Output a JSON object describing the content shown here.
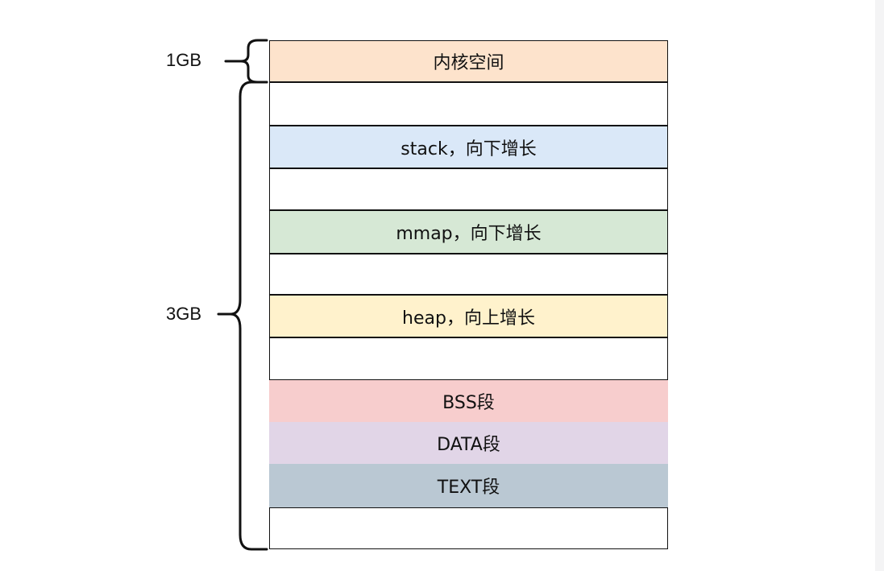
{
  "memory_layout": {
    "size_labels": {
      "kernel": "1GB",
      "user": "3GB"
    },
    "segments": [
      {
        "id": "kernel",
        "label": "内核空间",
        "color": "#fde3cc"
      },
      {
        "id": "gap1",
        "label": "",
        "color": "#ffffff"
      },
      {
        "id": "stack",
        "label": "stack，向下增长",
        "color": "#dae8f8"
      },
      {
        "id": "gap2",
        "label": "",
        "color": "#ffffff"
      },
      {
        "id": "mmap",
        "label": "mmap，向下增长",
        "color": "#d6e8d5"
      },
      {
        "id": "gap3",
        "label": "",
        "color": "#ffffff"
      },
      {
        "id": "heap",
        "label": "heap，向上增长",
        "color": "#fff2cc"
      },
      {
        "id": "gap4",
        "label": "",
        "color": "#ffffff"
      },
      {
        "id": "bss",
        "label": "BSS段",
        "color": "#f7cdcd"
      },
      {
        "id": "data",
        "label": "DATA段",
        "color": "#e1d5e7"
      },
      {
        "id": "text",
        "label": "TEXT段",
        "color": "#bac8d3"
      },
      {
        "id": "gap5",
        "label": "",
        "color": "#ffffff"
      }
    ]
  }
}
